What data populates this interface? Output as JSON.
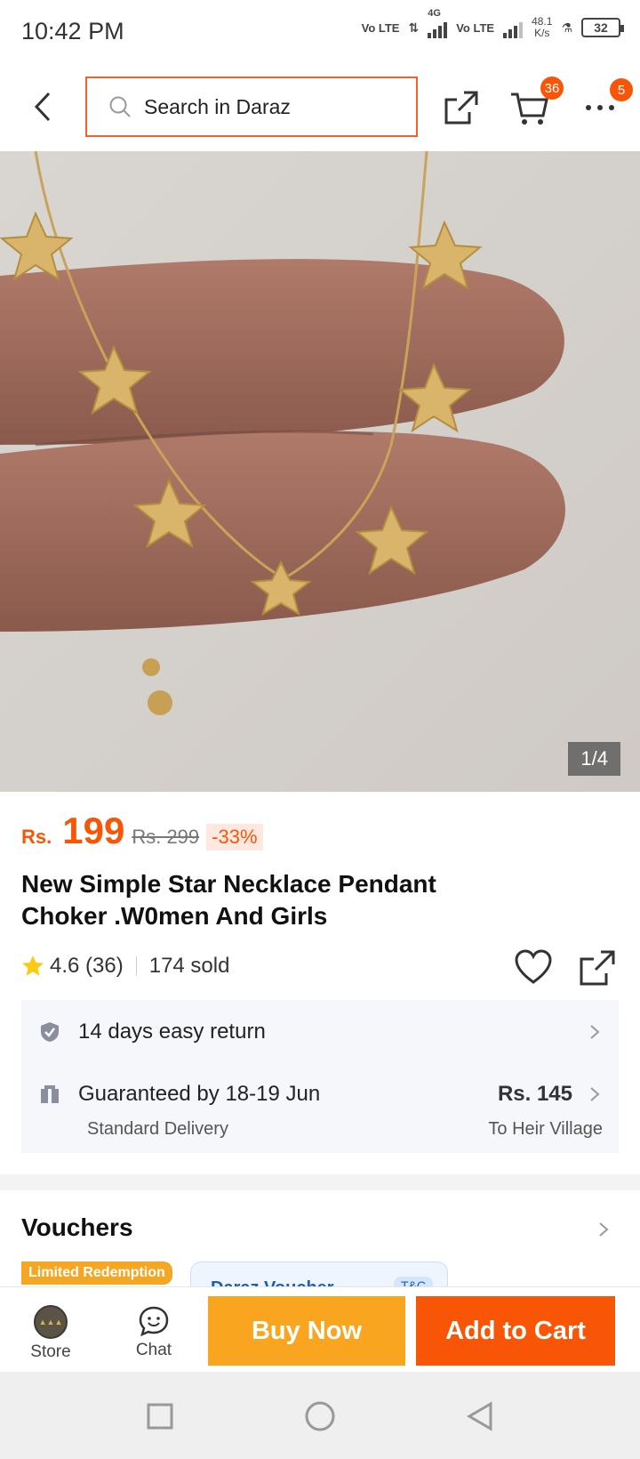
{
  "status": {
    "time": "10:42 PM",
    "net1": "Vo LTE",
    "net2": "4G",
    "net3": "Vo LTE",
    "speed_value": "48.1",
    "speed_unit": "K/s",
    "battery": "32"
  },
  "header": {
    "search_placeholder": "Search in Daraz",
    "cart_count": "36",
    "more_count": "5"
  },
  "hero": {
    "counter": "1/4"
  },
  "product": {
    "currency": "Rs.",
    "price": "199",
    "old_price": "Rs. 299",
    "discount": "-33%",
    "title": "New Simple Star Necklace Pendant Choker .W0men And Girls",
    "rating": "4.6 (36)",
    "sold": "174 sold"
  },
  "info": {
    "return_text": "14 days easy return",
    "delivery_text": "Guaranteed by 18-19 Jun",
    "delivery_type": "Standard Delivery",
    "shipping_price": "Rs. 145",
    "destination": "To Heir Village"
  },
  "vouchers": {
    "heading": "Vouchers",
    "limited_tag": "Limited Redemption",
    "voucher_name": "Daraz Voucher",
    "tc": "T&C"
  },
  "actions": {
    "store": "Store",
    "chat": "Chat",
    "buy_now": "Buy Now",
    "add_to_cart": "Add to Cart"
  },
  "colors": {
    "accent": "#f85606",
    "buy_now": "#f9a51f",
    "search_border": "#f2612a"
  }
}
